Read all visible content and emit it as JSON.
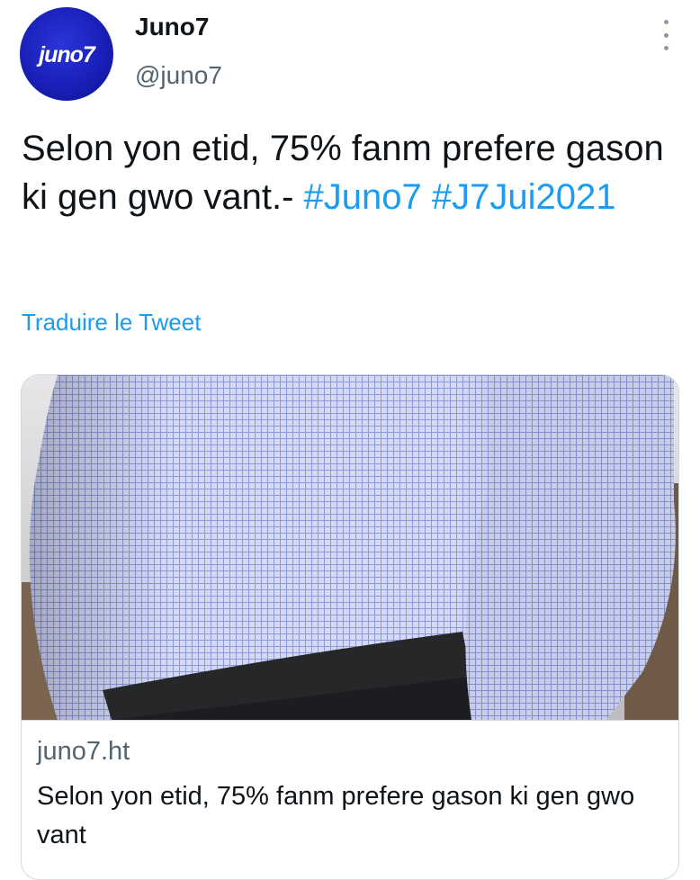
{
  "account": {
    "avatar_logo_text": "juno7",
    "avatar_color": "#1a1fb8",
    "display_name": "Juno7",
    "handle": "@juno7"
  },
  "menu": {
    "icon": "more-vertical-icon"
  },
  "tweet": {
    "text_plain": "Selon yon etid, 75% fanm prefere gason ki gen gwo vant.- ",
    "hashtags": [
      "#Juno7",
      "#J7Jui2021"
    ],
    "translate_label": "Traduire le Tweet",
    "link_color": "#1d9bf0"
  },
  "card": {
    "domain": "juno7.ht",
    "title": "Selon yon etid, 75% fanm prefere gason ki gen gwo vant"
  }
}
